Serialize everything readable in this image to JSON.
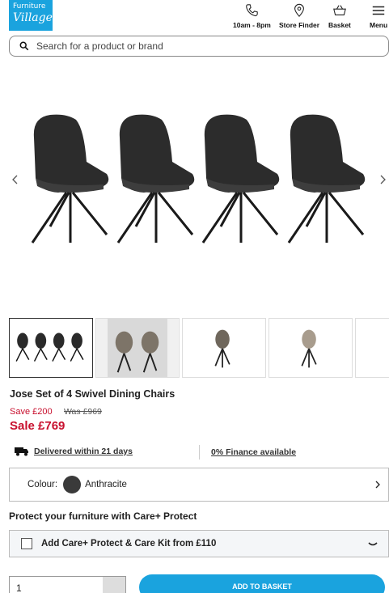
{
  "brand": {
    "logo_line1": "Furniture",
    "logo_line2": "Village"
  },
  "header": {
    "nav": [
      {
        "label": "10am - 8pm",
        "icon": "phone-icon"
      },
      {
        "label": "Store Finder",
        "icon": "location-pin-icon"
      },
      {
        "label": "Basket",
        "icon": "basket-icon"
      },
      {
        "label": "Menu",
        "icon": "menu-icon"
      }
    ]
  },
  "search": {
    "placeholder": "Search for a product or brand"
  },
  "gallery": {
    "main_image": "four-charcoal-swivel-chairs",
    "thumbnails": 5,
    "active_thumbnail": 1
  },
  "product": {
    "title": "Jose Set of 4 Swivel Dining Chairs",
    "save": "Save £200",
    "was": "Was £969",
    "sale": "Sale £769",
    "delivery": "Delivered within 21 days",
    "finance": "0% Finance available",
    "colour_label": "Colour:",
    "colour_value": "Anthracite",
    "colour_swatch": "#3a3a3a"
  },
  "care": {
    "heading": "Protect your furniture with Care+ Protect",
    "option": "Add Care+ Protect & Care Kit from £110"
  },
  "purchase": {
    "quantity": "1",
    "button": "ADD TO BASKET"
  },
  "colors": {
    "brand_blue": "#1aa3de",
    "sale_red": "#c8102e"
  }
}
